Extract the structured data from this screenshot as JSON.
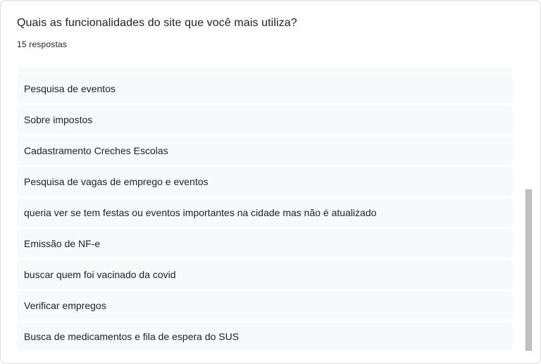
{
  "question": {
    "title": "Quais as funcionalidades do site que você mais utiliza?",
    "response_count": "15 respostas"
  },
  "responses": [
    "",
    "Pesquisa de eventos",
    "Sobre impostos",
    "Cadastramento Creches Escolas",
    "Pesquisa de vagas de emprego e eventos",
    "queria ver se tem festas ou eventos importantes na cidade mas não é atualizado",
    "Emissão de NF-e",
    "buscar quem foi vacinado da covid",
    "Verificar empregos",
    "Busca de medicamentos e fila de espera do SUS"
  ],
  "scrollbar": {
    "position_fraction": 0.43,
    "visible_fraction": 0.57
  }
}
